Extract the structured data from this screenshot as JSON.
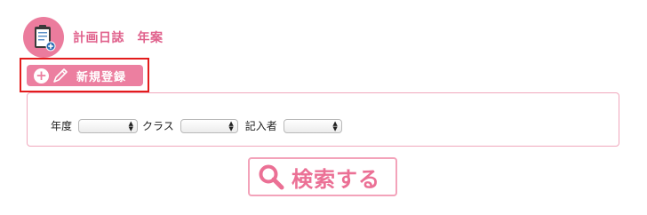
{
  "header": {
    "title": "計画日誌　年案",
    "icon": "clipboard-icon"
  },
  "register": {
    "label": "新規登録",
    "icons": [
      "plus-circle-icon",
      "pencil-icon"
    ]
  },
  "filters": {
    "year_label": "年度",
    "class_label": "クラス",
    "author_label": "記入者",
    "year_value": "",
    "class_value": "",
    "author_value": ""
  },
  "search": {
    "label": "検索する",
    "icon": "magnifier-icon"
  },
  "colors": {
    "accent": "#ec7fa0",
    "highlight_border": "#e31c1c",
    "panel_border": "#f0a8bd"
  }
}
